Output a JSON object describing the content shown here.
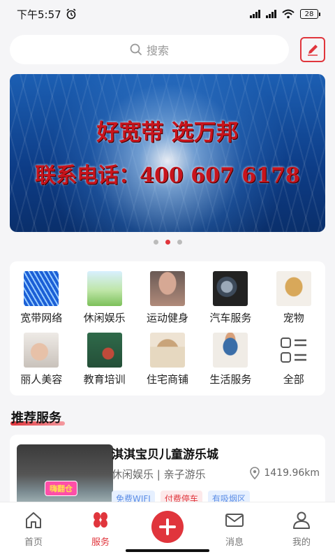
{
  "status_bar": {
    "time": "下午5:57",
    "battery": "28"
  },
  "search": {
    "placeholder": "搜索"
  },
  "banner": {
    "line1": "好宽带 选万邦",
    "line2": "联系电话：400 607 6178"
  },
  "carousel": {
    "count": 3,
    "active": 1
  },
  "categories": [
    {
      "label": "宽带网络",
      "icon": "fiber-optic-image",
      "color": "#1b5fd6"
    },
    {
      "label": "休闲娱乐",
      "icon": "park-scene-image",
      "color": "#8fd06a"
    },
    {
      "label": "运动健身",
      "icon": "fitness-woman-image",
      "color": "#b08a7a"
    },
    {
      "label": "汽车服务",
      "icon": "car-engine-image",
      "color": "#3d4a5a"
    },
    {
      "label": "宠物",
      "icon": "dog-image",
      "color": "#e0c79a"
    },
    {
      "label": "丽人美容",
      "icon": "beauty-treatment-image",
      "color": "#d9d2cc"
    },
    {
      "label": "教育培训",
      "icon": "classroom-teacher-image",
      "color": "#2f6a4a"
    },
    {
      "label": "住宅商铺",
      "icon": "house-keys-image",
      "color": "#c9a47a"
    },
    {
      "label": "生活服务",
      "icon": "cleaning-woman-image",
      "color": "#e7e0d6"
    },
    {
      "label": "全部",
      "icon": "all-list-icon",
      "color": "#555555"
    }
  ],
  "recommend": {
    "title": "推荐服务",
    "item": {
      "name": "淇淇宝贝儿童游乐城",
      "category": "休闲娱乐 | 亲子游乐",
      "distance": "1419.96km",
      "sign_text": "嗨翻仓",
      "tags": [
        {
          "text": "免费WIFI",
          "style": "blue"
        },
        {
          "text": "付费停车",
          "style": "red"
        },
        {
          "text": "有吸烟区",
          "style": "blue"
        }
      ]
    }
  },
  "tabbar": [
    {
      "label": "首页",
      "icon": "home-icon",
      "active": false
    },
    {
      "label": "服务",
      "icon": "service-icon",
      "active": true
    },
    {
      "label": "",
      "icon": "plus-icon",
      "active": false
    },
    {
      "label": "消息",
      "icon": "mail-icon",
      "active": false
    },
    {
      "label": "我的",
      "icon": "user-icon",
      "active": false
    }
  ],
  "colors": {
    "accent": "#e0353c",
    "background": "#f5f5f7"
  }
}
